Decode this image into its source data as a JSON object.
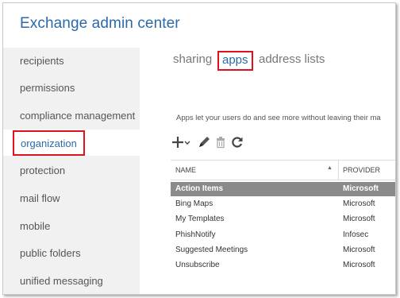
{
  "app": {
    "title": "Exchange admin center"
  },
  "sidebar": {
    "items": [
      {
        "label": "recipients"
      },
      {
        "label": "permissions"
      },
      {
        "label": "compliance management"
      },
      {
        "label": "organization"
      },
      {
        "label": "protection"
      },
      {
        "label": "mail flow"
      },
      {
        "label": "mobile"
      },
      {
        "label": "public folders"
      },
      {
        "label": "unified messaging"
      }
    ],
    "selected": "organization"
  },
  "tabs": [
    {
      "label": "sharing"
    },
    {
      "label": "apps"
    },
    {
      "label": "address lists"
    }
  ],
  "active_tab": "apps",
  "description": "Apps let your users do and see more without leaving their ma",
  "toolbar": {
    "icons": [
      "add-icon",
      "dropdown-caret-icon",
      "edit-icon",
      "delete-icon",
      "refresh-icon"
    ]
  },
  "grid": {
    "columns": [
      "NAME",
      "PROVIDER"
    ],
    "sort_indicator": "▲",
    "rows": [
      {
        "name": "Action Items",
        "provider": "Microsoft",
        "selected": true
      },
      {
        "name": "Bing Maps",
        "provider": "Microsoft"
      },
      {
        "name": "My Templates",
        "provider": "Microsoft"
      },
      {
        "name": "PhishNotify",
        "provider": "Infosec"
      },
      {
        "name": "Suggested Meetings",
        "provider": "Microsoft"
      },
      {
        "name": "Unsubscribe",
        "provider": "Microsoft"
      }
    ]
  },
  "colors": {
    "accent": "#2a6aa8",
    "highlight_box": "#e0101c",
    "selected_row": "#8a8a8a",
    "sidebar_bg": "#f1f1f1"
  }
}
